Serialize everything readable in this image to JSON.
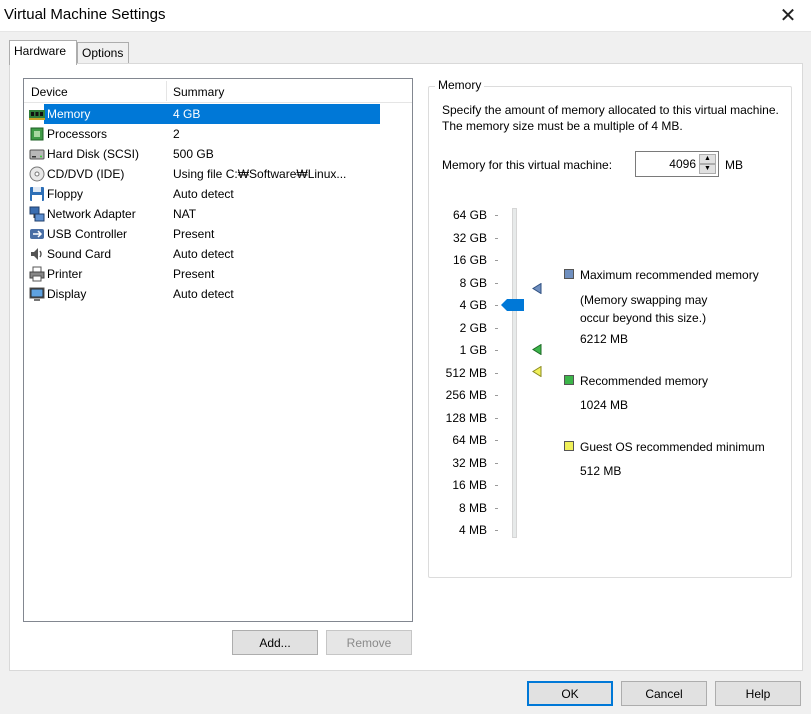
{
  "window": {
    "title": "Virtual Machine Settings",
    "close_glyph": "✕"
  },
  "tabs": [
    {
      "label": "Hardware",
      "active": true
    },
    {
      "label": "Options",
      "active": false
    }
  ],
  "device_list": {
    "columns": [
      "Device",
      "Summary"
    ],
    "rows": [
      {
        "icon": "memory-icon",
        "device": "Memory",
        "summary": "4 GB",
        "selected": true
      },
      {
        "icon": "processor-icon",
        "device": "Processors",
        "summary": "2"
      },
      {
        "icon": "hard-disk-icon",
        "device": "Hard Disk (SCSI)",
        "summary": "500 GB"
      },
      {
        "icon": "cd-dvd-icon",
        "device": "CD/DVD (IDE)",
        "summary": "Using file C:₩Software₩Linux..."
      },
      {
        "icon": "floppy-icon",
        "device": "Floppy",
        "summary": "Auto detect"
      },
      {
        "icon": "network-icon",
        "device": "Network Adapter",
        "summary": "NAT"
      },
      {
        "icon": "usb-icon",
        "device": "USB Controller",
        "summary": "Present"
      },
      {
        "icon": "sound-icon",
        "device": "Sound Card",
        "summary": "Auto detect"
      },
      {
        "icon": "printer-icon",
        "device": "Printer",
        "summary": "Present"
      },
      {
        "icon": "display-icon",
        "device": "Display",
        "summary": "Auto detect"
      }
    ]
  },
  "list_buttons": {
    "add": "Add...",
    "remove": "Remove"
  },
  "memory": {
    "group_title": "Memory",
    "description": "Specify the amount of memory allocated to this virtual machine. The memory size must be a multiple of 4 MB.",
    "field_label": "Memory for this virtual machine:",
    "value": "4096",
    "unit": "MB",
    "scale_labels": [
      "64 GB",
      "32 GB",
      "16 GB",
      "8 GB",
      "4 GB",
      "2 GB",
      "1 GB",
      "512 MB",
      "256 MB",
      "128 MB",
      "64 MB",
      "32 MB",
      "16 MB",
      "8 MB",
      "4 MB"
    ],
    "slider_value": "4 GB",
    "legend": {
      "max_label": "Maximum recommended memory",
      "max_note": "(Memory swapping may occur beyond this size.)",
      "max_value": "6212 MB",
      "rec_label": "Recommended memory",
      "rec_value": "1024 MB",
      "min_label": "Guest OS recommended minimum",
      "min_value": "512 MB"
    },
    "colors": {
      "max": "#6f8fbf",
      "recommended": "#3cb54a",
      "minimum": "#f0f05a",
      "thumb": "#0078d7"
    }
  },
  "footer_buttons": {
    "ok": "OK",
    "cancel": "Cancel",
    "help": "Help"
  }
}
